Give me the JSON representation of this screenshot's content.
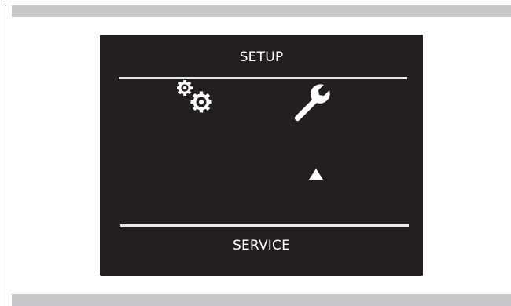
{
  "menu": {
    "title": "SETUP",
    "footer_label": "SERVICE",
    "items": [
      {
        "icon": "gears-icon",
        "label": ""
      },
      {
        "icon": "wrench-icon",
        "label": "",
        "selected": true
      }
    ]
  },
  "colors": {
    "screen_background": "#231f20",
    "text": "#ffffff",
    "divider": "#e9e9e9",
    "frame_bars": "#c8c8ca"
  }
}
